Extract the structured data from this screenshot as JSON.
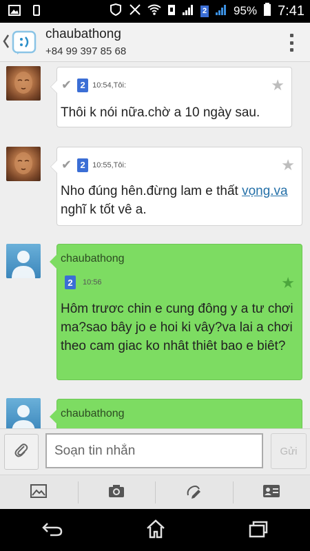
{
  "status_bar": {
    "battery": "95%",
    "time": "7:41",
    "sim_label": "2"
  },
  "header": {
    "contact_name": "chaubathong",
    "phone": "+84 99 397 85 68"
  },
  "messages": [
    {
      "meta": "10:54,Tôi:",
      "text": "Thôi k nói nữa.chờ a 10 ngày sau."
    },
    {
      "meta": "10:55,Tôi:",
      "text_before_link": "Nho đúng hên.đừng lam e thất ",
      "link": "vọng.va",
      "text_after_link": " nghĩ k tốt vê a."
    },
    {
      "sender": "chaubathong",
      "meta": "10:56",
      "text": "Hôm trươc chin e cung đông y a tư chơi ma?sao bây jo e hoi ki vây?va lai a chơi theo cam giac ko nhât thiêt bao e biêt?"
    },
    {
      "sender": "chaubathong"
    }
  ],
  "sim_badge": "2",
  "compose": {
    "placeholder": "Soạn tin nhắn",
    "send_label": "Gửi"
  },
  "icons": {
    "attach": "paperclip-icon",
    "image": "image-icon",
    "camera": "camera-icon",
    "draw": "pencil-icon",
    "contact": "contact-card-icon",
    "back": "back-icon",
    "home": "home-icon",
    "recents": "recents-icon"
  },
  "colors": {
    "outgoing_bubble": "#ffffff",
    "incoming_bubble": "#7ddc62",
    "sim_badge": "#3b6ed5",
    "link": "#2470a8"
  }
}
